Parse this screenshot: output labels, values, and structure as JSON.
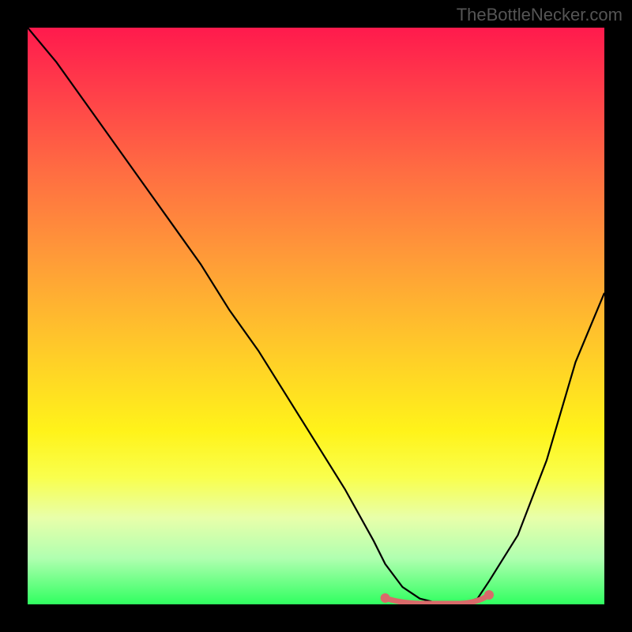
{
  "watermark": "TheBottleNecker.com",
  "chart_data": {
    "type": "line",
    "title": "",
    "xlabel": "",
    "ylabel": "",
    "xlim": [
      0,
      100
    ],
    "ylim": [
      0,
      100
    ],
    "grid": false,
    "series": [
      {
        "name": "bottleneck-curve",
        "x": [
          0,
          5,
          10,
          15,
          20,
          25,
          30,
          35,
          40,
          45,
          50,
          55,
          60,
          62,
          65,
          68,
          72,
          75,
          78,
          80,
          85,
          90,
          95,
          100
        ],
        "y": [
          100,
          94,
          87,
          80,
          73,
          66,
          59,
          51,
          44,
          36,
          28,
          20,
          11,
          7,
          3,
          1,
          0,
          0,
          1,
          4,
          12,
          25,
          42,
          54
        ]
      }
    ],
    "highlight": {
      "name": "optimal-range",
      "x_start": 62,
      "x_end": 80,
      "y": 0
    },
    "background_gradient": {
      "top": "#ff1a4d",
      "mid": "#fff31a",
      "bottom": "#30ff60"
    }
  }
}
